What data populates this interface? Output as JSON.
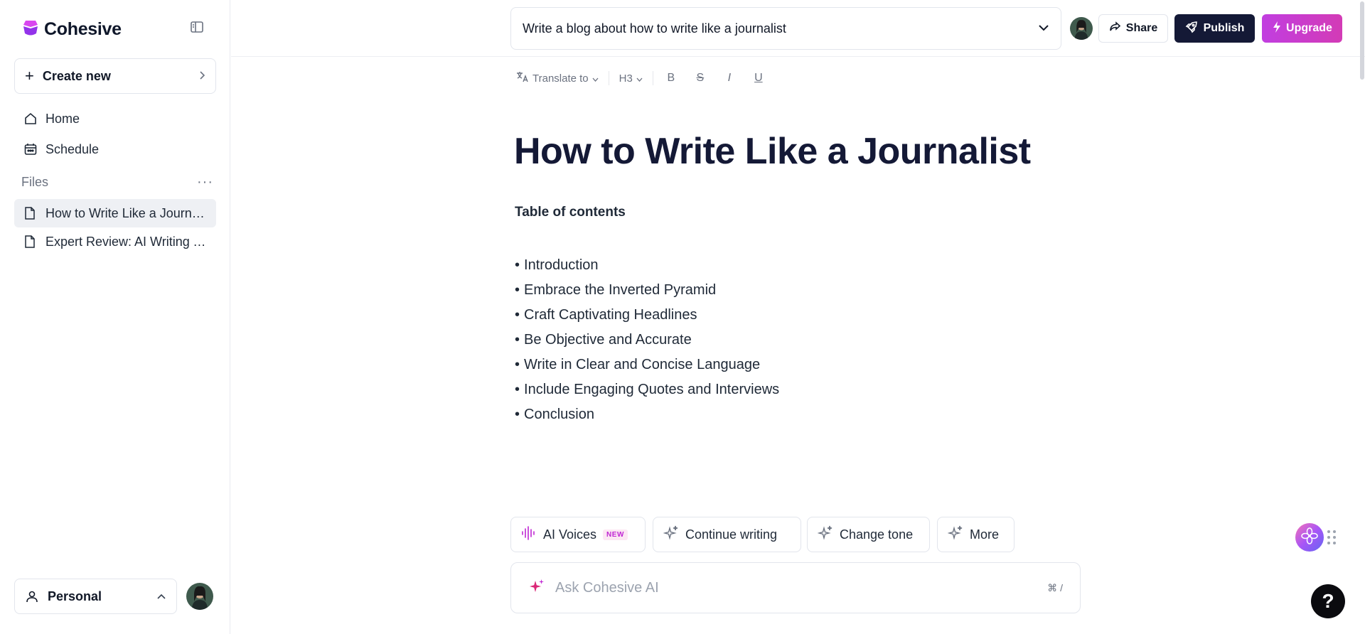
{
  "app": {
    "brand_name": "Cohesive",
    "accent": "#c13ee0",
    "dark": "#141936"
  },
  "sidebar": {
    "create_new_label": "Create new",
    "nav": [
      {
        "label": "Home",
        "icon": "home-icon"
      },
      {
        "label": "Schedule",
        "icon": "calendar-icon"
      }
    ],
    "files_label": "Files",
    "files": [
      {
        "label": "How to Write Like a Journalist",
        "active": true
      },
      {
        "label": "Expert Review: AI Writing Tools",
        "active": false
      }
    ],
    "workspace_label": "Personal"
  },
  "header": {
    "prompt_text": "Write a blog about how to write like a journalist",
    "share_label": "Share",
    "publish_label": "Publish",
    "upgrade_label": "Upgrade"
  },
  "toolbar": {
    "translate_label": "Translate to",
    "heading_label": "H3",
    "format_buttons": [
      "B",
      "S",
      "I",
      "U"
    ]
  },
  "document": {
    "title": "How to Write Like a Journalist",
    "toc_heading": "Table of contents",
    "toc_items": [
      "Introduction",
      "Embrace the Inverted Pyramid",
      "Craft Captivating Headlines",
      "Be Objective and Accurate",
      "Write in Clear and Concise Language",
      "Include Engaging Quotes and Interviews",
      "Conclusion"
    ]
  },
  "ai_actions": {
    "ai_voices_label": "AI Voices",
    "new_badge": "NEW",
    "continue_label": "Continue writing",
    "tone_label": "Change tone",
    "more_label": "More",
    "ask_placeholder": "Ask Cohesive AI",
    "shortcut": "⌘ /"
  },
  "help_label": "?"
}
